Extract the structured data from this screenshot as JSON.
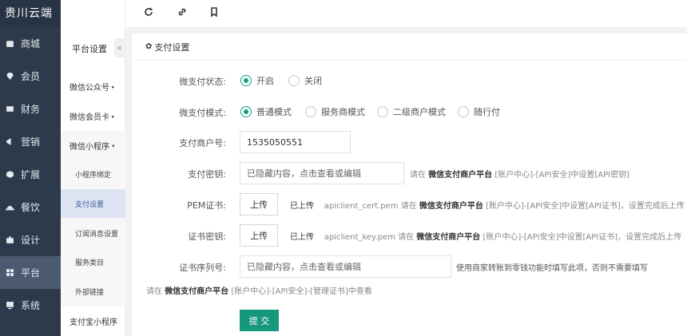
{
  "brand": "贵川云端",
  "toolbar": {
    "icons": [
      "menu-indent-icon",
      "fullscreen-icon",
      "refresh-icon",
      "link-icon",
      "bookmark-icon"
    ]
  },
  "sidebar": {
    "items": [
      {
        "label": "商城",
        "icon": "store-icon"
      },
      {
        "label": "会员",
        "icon": "diamond-icon"
      },
      {
        "label": "财务",
        "icon": "finance-icon"
      },
      {
        "label": "营销",
        "icon": "megaphone-icon"
      },
      {
        "label": "扩展",
        "icon": "cube-icon"
      },
      {
        "label": "餐饮",
        "icon": "dish-icon"
      },
      {
        "label": "设计",
        "icon": "puzzle-icon"
      },
      {
        "label": "平台",
        "icon": "grid-icon",
        "active": true
      },
      {
        "label": "系统",
        "icon": "monitor-icon"
      }
    ]
  },
  "subnav": {
    "title": "平台设置",
    "collapse": "«",
    "groups": [
      {
        "label": "微信公众号",
        "caret": "▸"
      },
      {
        "label": "微信会员卡",
        "caret": "▸"
      },
      {
        "label": "微信小程序",
        "caret": "▾"
      }
    ],
    "items": [
      "小程序绑定",
      "支付设置",
      "订阅消息设置",
      "服务类目",
      "外部链接"
    ],
    "last_group": "支付宝小程序"
  },
  "card": {
    "title": "支付设置",
    "status_label": "微支付状态:",
    "status_options": [
      "开启",
      "关闭"
    ],
    "mode_label": "微支付模式:",
    "mode_options": [
      "普通模式",
      "服务商模式",
      "二级商户模式",
      "随行付"
    ],
    "merchant_label": "支付商户号:",
    "merchant_value": "1535050551",
    "secret_label": "支付密钥:",
    "secret_placeholder": "已隐藏内容，点击查看或编辑",
    "secret_hint_pre": "请在",
    "secret_hint_platform": "微信支付商户平台",
    "secret_hint_post": "[账户中心]-[API安全]中设置[API密钥]",
    "pem_label": "PEM证书:",
    "upload_label": "上传",
    "uploaded": "已上传",
    "pem_file": "apiclient_cert.pem",
    "pem_hint_pre": "请在",
    "pem_hint_platform": "微信支付商户平台",
    "pem_hint_post": "[账户中心]-[API安全]中设置[API证书]，设置完成后上传",
    "key_label": "证书密钥:",
    "key_file": "apiclient_key.pem",
    "key_hint_pre": "请在",
    "key_hint_platform": "微信支付商户平台",
    "key_hint_post": "[账户中心]-[API安全]中设置[API证书]，设置完成后上传",
    "serial_label": "证书序列号:",
    "serial_placeholder": "已隐藏内容，点击查看或编辑",
    "serial_hint": "使用商家转账到零钱功能时填写此项，否则不需要填写",
    "serial_hint2_pre": "请在",
    "serial_hint2_platform": "微信支付商户平台",
    "serial_hint2_post": "[账户中心]-[API安全]-[管理证书]中查看",
    "submit_label": "提 交"
  },
  "colors": {
    "sidebar_bg": "#2d3a4b",
    "accent": "#16987e",
    "active_sub_bg": "#dfe4f5"
  }
}
